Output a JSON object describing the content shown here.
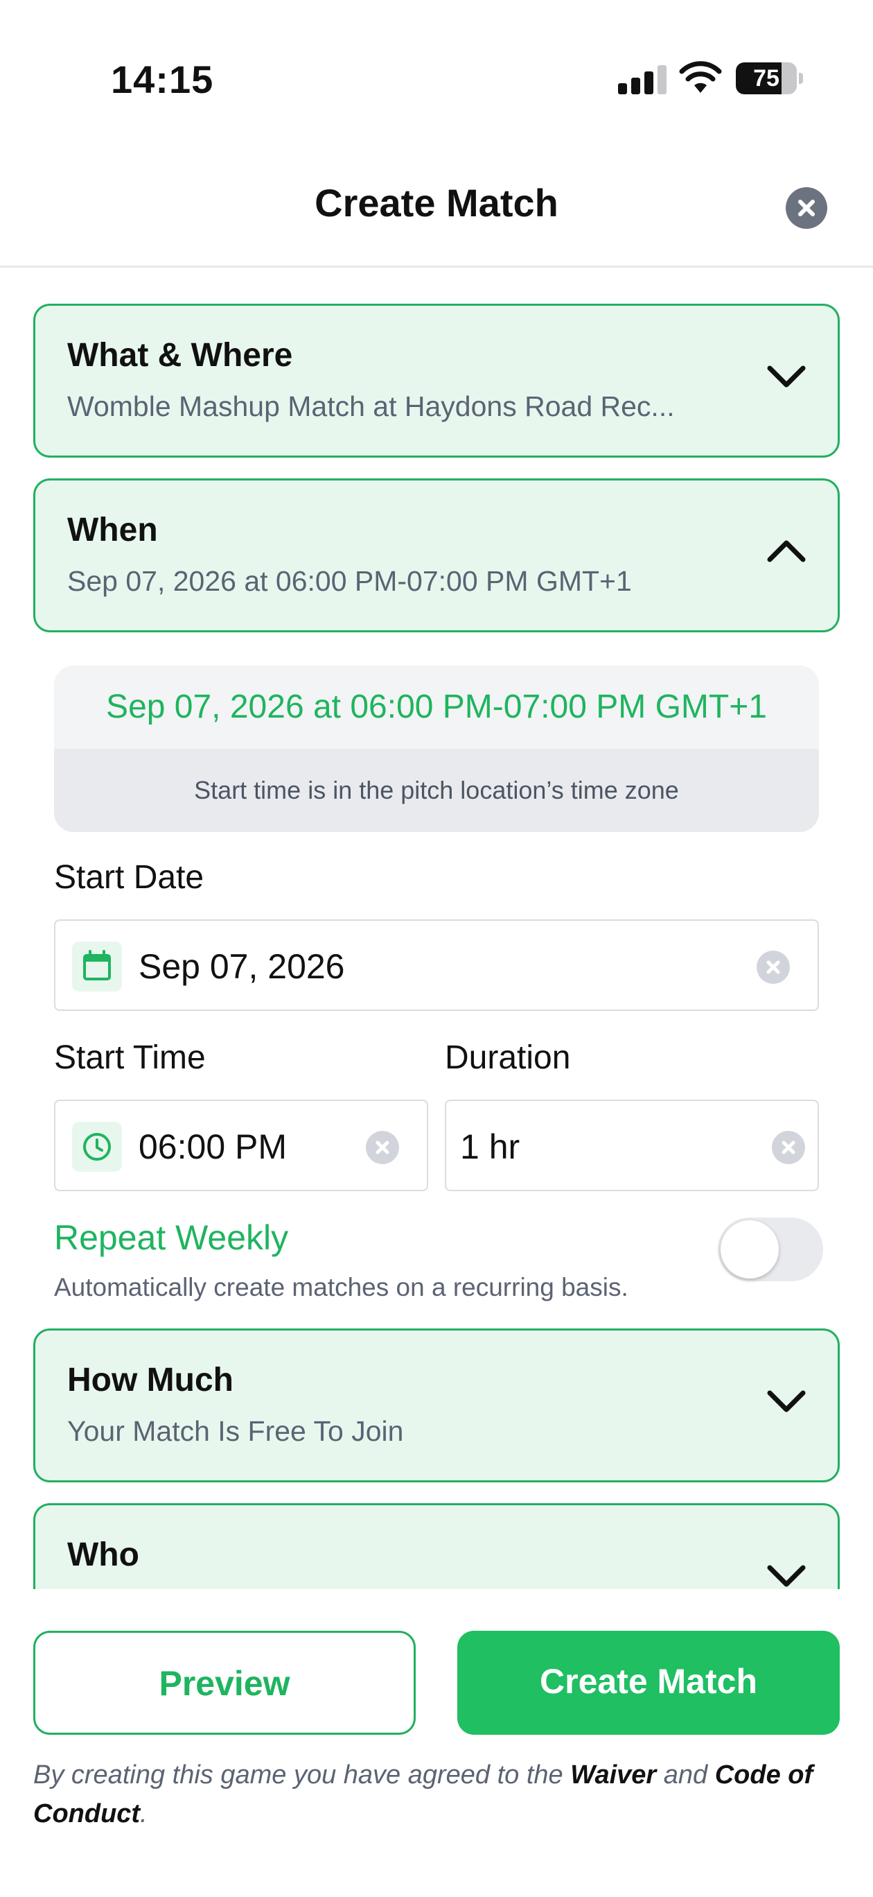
{
  "status_bar": {
    "time": "14:15",
    "battery": "75",
    "battery_level": 0.75
  },
  "header": {
    "title": "Create Match"
  },
  "sections": {
    "what_where": {
      "title": "What & Where",
      "subtitle": "Womble Mashup Match at Haydons Road Rec..."
    },
    "when": {
      "title": "When",
      "subtitle": "Sep 07, 2026 at 06:00 PM-07:00 PM GMT+1"
    },
    "how_much": {
      "title": "How Much",
      "subtitle": "Your Match Is Free To Join"
    },
    "who": {
      "title": "Who"
    }
  },
  "when_panel": {
    "summary": "Sep 07, 2026 at 06:00 PM-07:00 PM GMT+1",
    "timezone_note": "Start time is in the pitch location’s time zone",
    "start_date": {
      "label": "Start Date",
      "value": "Sep 07, 2026"
    },
    "start_time": {
      "label": "Start Time",
      "value": "06:00 PM"
    },
    "duration": {
      "label": "Duration",
      "value": "1 hr"
    },
    "repeat": {
      "title": "Repeat Weekly",
      "description": "Automatically create matches on a recurring basis.",
      "enabled": false
    }
  },
  "footer": {
    "preview_label": "Preview",
    "create_label": "Create Match",
    "legal_prefix": "By creating this game you have agreed to the",
    "waiver": "Waiver",
    "and": "and",
    "code_of_conduct": "Code of Conduct",
    "period": "."
  },
  "colors": {
    "accent": "#1fbf62",
    "card_bg": "#e8f7ee",
    "card_border": "#22b060",
    "muted_text": "#5b6373"
  }
}
